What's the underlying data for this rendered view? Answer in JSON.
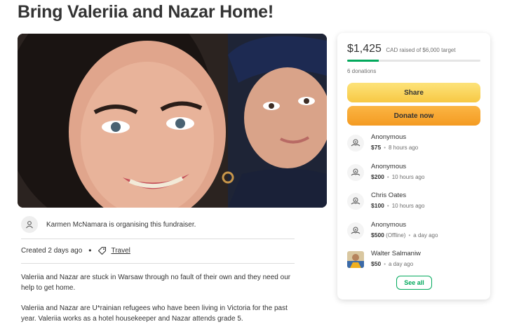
{
  "page": {
    "title": "Bring Valeriia and Nazar Home!"
  },
  "hero": {
    "image": "fundraiser-photo-woman-and-boy"
  },
  "organiser": {
    "icon": "user-icon",
    "text": "Karmen McNamara is organising this fundraiser."
  },
  "meta": {
    "created": "Created 2 days ago",
    "dot": "•",
    "tag_icon": "tag-icon",
    "category": "Travel"
  },
  "story": {
    "paragraphs": [
      "Valeriia and Nazar are stuck in Warsaw through no fault of their own and they need our help to get home.",
      "Valeriia and Nazar are U*rainian refugees who have been living in Victoria for the past year. Valeriia works as a hotel housekeeper and Nazar attends grade 5."
    ]
  },
  "card": {
    "raised_amount": "$1,425",
    "raised_target": "CAD raised of $6,000 target",
    "progress_fraction": 0.2375,
    "donation_count": "6 donations",
    "share_label": "Share",
    "donate_label": "Donate now",
    "see_all_label": "See all",
    "donations": [
      {
        "name": "Anonymous",
        "amount": "$75",
        "note": "",
        "time": "8 hours ago",
        "icon": "donor-hands-icon"
      },
      {
        "name": "Anonymous",
        "amount": "$200",
        "note": "",
        "time": "10 hours ago",
        "icon": "donor-hands-icon"
      },
      {
        "name": "Chris Oates",
        "amount": "$100",
        "note": "",
        "time": "10 hours ago",
        "icon": "donor-hands-icon"
      },
      {
        "name": "Anonymous",
        "amount": "$500",
        "note": "(Offline)",
        "time": "a day ago",
        "icon": "donor-hands-icon"
      },
      {
        "name": "Walter Salmaniw",
        "amount": "$50",
        "note": "",
        "time": "a day ago",
        "icon": "donor-photo"
      }
    ]
  },
  "colors": {
    "accent_green": "#02a95c",
    "share_yellow": "#f9d25b",
    "donate_orange": "#f6a82f",
    "text": "#333333"
  }
}
